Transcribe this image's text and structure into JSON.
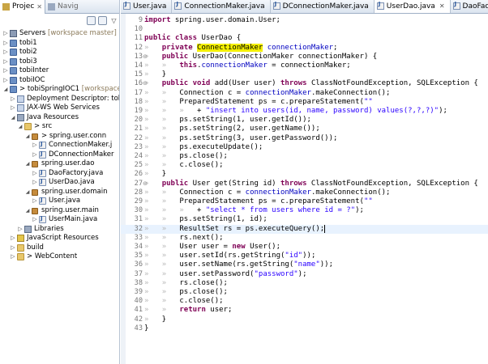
{
  "left_panel": {
    "tabs": [
      {
        "label": "Projec",
        "active": true
      },
      {
        "label": "Navig",
        "active": false
      }
    ],
    "tree": [
      {
        "depth": 0,
        "arrow": "▷",
        "icon": "server-icon",
        "label": "Servers",
        "suffix": "[workspace master]"
      },
      {
        "depth": 0,
        "arrow": "▷",
        "icon": "project-icon",
        "label": "tobi1",
        "suffix": ""
      },
      {
        "depth": 0,
        "arrow": "▷",
        "icon": "project-icon",
        "label": "tobi2",
        "suffix": ""
      },
      {
        "depth": 0,
        "arrow": "▷",
        "icon": "project-icon",
        "label": "tobi3",
        "suffix": ""
      },
      {
        "depth": 0,
        "arrow": "▷",
        "icon": "project-icon",
        "label": "tobiInter",
        "suffix": ""
      },
      {
        "depth": 0,
        "arrow": "▷",
        "icon": "project-icon",
        "label": "tobiIOC",
        "suffix": ""
      },
      {
        "depth": 0,
        "arrow": "◢",
        "icon": "project-icon",
        "label": "> tobiSpringIOC1",
        "suffix": "[workspace m"
      },
      {
        "depth": 1,
        "arrow": "▷",
        "icon": "descriptor-icon",
        "label": "Deployment Descriptor: tobiS",
        "suffix": ""
      },
      {
        "depth": 1,
        "arrow": "▷",
        "icon": "web-services-icon",
        "label": "JAX-WS Web Services",
        "suffix": ""
      },
      {
        "depth": 1,
        "arrow": "◢",
        "icon": "java-resources-icon",
        "label": "Java Resources",
        "suffix": ""
      },
      {
        "depth": 2,
        "arrow": "◢",
        "icon": "source-folder-icon",
        "label": "> src",
        "suffix": ""
      },
      {
        "depth": 3,
        "arrow": "◢",
        "icon": "package-icon",
        "label": "> spring.user.conn",
        "suffix": ""
      },
      {
        "depth": 4,
        "arrow": "▷",
        "icon": "java-file-icon",
        "label": "ConnectionMaker.j",
        "suffix": ""
      },
      {
        "depth": 4,
        "arrow": "▷",
        "icon": "java-file-icon",
        "label": "DConnectionMaker",
        "suffix": ""
      },
      {
        "depth": 3,
        "arrow": "◢",
        "icon": "package-icon",
        "label": "spring.user.dao",
        "suffix": ""
      },
      {
        "depth": 4,
        "arrow": "▷",
        "icon": "java-file-icon",
        "label": "DaoFactory.java",
        "suffix": ""
      },
      {
        "depth": 4,
        "arrow": "▷",
        "icon": "java-file-icon",
        "label": "UserDao.java",
        "suffix": ""
      },
      {
        "depth": 3,
        "arrow": "◢",
        "icon": "package-icon",
        "label": "spring.user.domain",
        "suffix": ""
      },
      {
        "depth": 4,
        "arrow": "▷",
        "icon": "java-file-icon",
        "label": "User.java",
        "suffix": ""
      },
      {
        "depth": 3,
        "arrow": "◢",
        "icon": "package-icon",
        "label": "spring.user.main",
        "suffix": ""
      },
      {
        "depth": 4,
        "arrow": "▷",
        "icon": "java-file-icon",
        "label": "UserMain.java",
        "suffix": ""
      },
      {
        "depth": 2,
        "arrow": "▷",
        "icon": "libraries-icon",
        "label": "Libraries",
        "suffix": ""
      },
      {
        "depth": 1,
        "arrow": "▷",
        "icon": "javascript-resources-icon",
        "label": "JavaScript Resources",
        "suffix": ""
      },
      {
        "depth": 1,
        "arrow": "▷",
        "icon": "folder-icon",
        "label": "build",
        "suffix": ""
      },
      {
        "depth": 1,
        "arrow": "▷",
        "icon": "folder-icon",
        "label": "> WebContent",
        "suffix": ""
      }
    ]
  },
  "editor": {
    "tabs": [
      {
        "label": "User.java",
        "active": false
      },
      {
        "label": "ConnectionMaker.java",
        "active": false
      },
      {
        "label": "DConnectionMaker.java",
        "active": false
      },
      {
        "label": "UserDao.java",
        "active": true,
        "close": "✕"
      },
      {
        "label": "DaoFactory.jav",
        "active": false
      }
    ],
    "lines": [
      {
        "n": "9",
        "fold": "",
        "hl": false,
        "html": "<span class=\"kw\">import</span> spring.user.domain.User;"
      },
      {
        "n": "10",
        "fold": "",
        "hl": false,
        "html": ""
      },
      {
        "n": "11",
        "fold": "",
        "hl": false,
        "html": "<span class=\"kw\">public</span> <span class=\"kw\">class</span> UserDao {"
      },
      {
        "n": "12",
        "fold": "",
        "hl": false,
        "html": "<span class=\"ws\">»</span>   <span class=\"kw\">private</span> <span class=\"occ\">ConnectionMaker</span> <span class=\"fld\">connectionMaker</span>;"
      },
      {
        "n": "13",
        "fold": "⊖",
        "hl": false,
        "html": "<span class=\"ws\">»</span>   <span class=\"kw\">public</span> UserDao(ConnectionMaker connectionMaker) {"
      },
      {
        "n": "14",
        "fold": "",
        "hl": false,
        "html": "<span class=\"ws\">»</span>   <span class=\"ws\">»</span>   <span class=\"kw\">this</span>.<span class=\"fld\">connectionMaker</span> = connectionMaker;"
      },
      {
        "n": "15",
        "fold": "",
        "hl": false,
        "html": "<span class=\"ws\">»</span>   }"
      },
      {
        "n": "16",
        "fold": "⊖",
        "hl": false,
        "html": "<span class=\"ws\">»</span>   <span class=\"kw\">public</span> <span class=\"kw\">void</span> add(User user) <span class=\"kw\">throws</span> ClassNotFoundException, SQLException {"
      },
      {
        "n": "17",
        "fold": "",
        "hl": false,
        "html": "<span class=\"ws\">»</span>   <span class=\"ws\">»</span>   Connection c = <span class=\"fld\">connectionMaker</span>.makeConnection();"
      },
      {
        "n": "18",
        "fold": "",
        "hl": false,
        "html": "<span class=\"ws\">»</span>   <span class=\"ws\">»</span>   PreparedStatement ps = c.prepareStatement(<span class=\"str\">\"\"</span>"
      },
      {
        "n": "19",
        "fold": "",
        "hl": false,
        "html": "<span class=\"ws\">»</span>   <span class=\"ws\">»</span>   <span class=\"ws\">»</span>   + <span class=\"str\">\"insert into users(id, name, password) values(?,?,?)\"</span>);"
      },
      {
        "n": "20",
        "fold": "",
        "hl": false,
        "html": "<span class=\"ws\">»</span>   <span class=\"ws\">»</span>   ps.setString(1, user.getId());"
      },
      {
        "n": "21",
        "fold": "",
        "hl": false,
        "html": "<span class=\"ws\">»</span>   <span class=\"ws\">»</span>   ps.setString(2, user.getName());"
      },
      {
        "n": "22",
        "fold": "",
        "hl": false,
        "html": "<span class=\"ws\">»</span>   <span class=\"ws\">»</span>   ps.setString(3, user.getPassword());"
      },
      {
        "n": "23",
        "fold": "",
        "hl": false,
        "html": "<span class=\"ws\">»</span>   <span class=\"ws\">»</span>   ps.executeUpdate();"
      },
      {
        "n": "24",
        "fold": "",
        "hl": false,
        "html": "<span class=\"ws\">»</span>   <span class=\"ws\">»</span>   ps.close();"
      },
      {
        "n": "25",
        "fold": "",
        "hl": false,
        "html": "<span class=\"ws\">»</span>   <span class=\"ws\">»</span>   c.close();"
      },
      {
        "n": "26",
        "fold": "",
        "hl": false,
        "html": "<span class=\"ws\">»</span>   }"
      },
      {
        "n": "27",
        "fold": "⊖",
        "hl": false,
        "html": "<span class=\"ws\">»</span>   <span class=\"kw\">public</span> User get(String id) <span class=\"kw\">throws</span> ClassNotFoundException, SQLException {"
      },
      {
        "n": "28",
        "fold": "",
        "hl": false,
        "html": "<span class=\"ws\">»</span>   <span class=\"ws\">»</span>   Connection c = <span class=\"fld\">connectionMaker</span>.makeConnection();"
      },
      {
        "n": "29",
        "fold": "",
        "hl": false,
        "html": "<span class=\"ws\">»</span>   <span class=\"ws\">»</span>   PreparedStatement ps = c.prepareStatement(<span class=\"str\">\"\"</span>"
      },
      {
        "n": "30",
        "fold": "",
        "hl": false,
        "html": "<span class=\"ws\">»</span>   <span class=\"ws\">»</span>   <span class=\"ws\">»</span>   + <span class=\"str\">\"select * from users where id = ?\"</span>);"
      },
      {
        "n": "31",
        "fold": "",
        "hl": false,
        "html": "<span class=\"ws\">»</span>   <span class=\"ws\">»</span>   ps.setString(1, id);"
      },
      {
        "n": "32",
        "fold": "",
        "hl": true,
        "html": "<span class=\"ws\">»</span>   <span class=\"ws\">»</span>   ResultSet rs = ps.executeQuery();<span class=\"caret\"></span>"
      },
      {
        "n": "33",
        "fold": "",
        "hl": false,
        "html": "<span class=\"ws\">»</span>   <span class=\"ws\">»</span>   rs.next();"
      },
      {
        "n": "34",
        "fold": "",
        "hl": false,
        "html": "<span class=\"ws\">»</span>   <span class=\"ws\">»</span>   User user = <span class=\"kw\">new</span> User();"
      },
      {
        "n": "35",
        "fold": "",
        "hl": false,
        "html": "<span class=\"ws\">»</span>   <span class=\"ws\">»</span>   user.setId(rs.getString(<span class=\"str\">\"id\"</span>));"
      },
      {
        "n": "36",
        "fold": "",
        "hl": false,
        "html": "<span class=\"ws\">»</span>   <span class=\"ws\">»</span>   user.setName(rs.getString(<span class=\"str\">\"name\"</span>));"
      },
      {
        "n": "37",
        "fold": "",
        "hl": false,
        "html": "<span class=\"ws\">»</span>   <span class=\"ws\">»</span>   user.setPassword(<span class=\"str\">\"password\"</span>);"
      },
      {
        "n": "38",
        "fold": "",
        "hl": false,
        "html": "<span class=\"ws\">»</span>   <span class=\"ws\">»</span>   rs.close();"
      },
      {
        "n": "39",
        "fold": "",
        "hl": false,
        "html": "<span class=\"ws\">»</span>   <span class=\"ws\">»</span>   ps.close();"
      },
      {
        "n": "40",
        "fold": "",
        "hl": false,
        "html": "<span class=\"ws\">»</span>   <span class=\"ws\">»</span>   c.close();"
      },
      {
        "n": "41",
        "fold": "",
        "hl": false,
        "html": "<span class=\"ws\">»</span>   <span class=\"ws\">»</span>   <span class=\"kw\">return</span> user;"
      },
      {
        "n": "42",
        "fold": "",
        "hl": false,
        "html": "<span class=\"ws\">»</span>   }"
      },
      {
        "n": "43",
        "fold": "",
        "hl": false,
        "html": "}"
      }
    ]
  },
  "colors": {
    "keyword": "#7f0055",
    "string": "#2a00ff",
    "field": "#0000c0",
    "occurrence_highlight": "#f4f000",
    "current_line": "#e8f2fe"
  }
}
